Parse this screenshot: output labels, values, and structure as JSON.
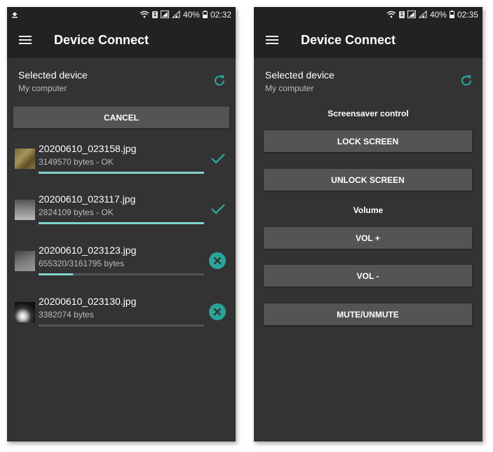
{
  "colors": {
    "accent": "#2aa398",
    "progress": "#7fd4cc",
    "background": "#333333",
    "appbar": "#222222",
    "button": "#545454"
  },
  "left": {
    "status": {
      "left_icon": "upload-icon",
      "battery": "40%",
      "time": "02:32"
    },
    "app_title": "Device Connect",
    "device": {
      "label": "Selected device",
      "name": "My computer"
    },
    "cancel_label": "CANCEL",
    "files": [
      {
        "name": "20200610_023158.jpg",
        "info": "3149570 bytes - OK",
        "progress": 1.0,
        "state": "done",
        "state_icon": "check-icon"
      },
      {
        "name": "20200610_023117.jpg",
        "info": "2824109 bytes - OK",
        "progress": 1.0,
        "state": "done",
        "state_icon": "check-icon"
      },
      {
        "name": "20200610_023123.jpg",
        "info": "655320/3161795 bytes",
        "progress": 0.207,
        "state": "in-progress",
        "state_icon": "cancel-circle-icon"
      },
      {
        "name": "20200610_023130.jpg",
        "info": "3382074 bytes",
        "progress": 0.0,
        "state": "pending",
        "state_icon": "cancel-circle-icon"
      }
    ]
  },
  "right": {
    "status": {
      "battery": "40%",
      "time": "02:35"
    },
    "app_title": "Device Connect",
    "device": {
      "label": "Selected device",
      "name": "My computer"
    },
    "screensaver_label": "Screensaver control",
    "lock_label": "LOCK SCREEN",
    "unlock_label": "UNLOCK SCREEN",
    "volume_label": "Volume",
    "vol_up_label": "VOL +",
    "vol_down_label": "VOL -",
    "mute_label": "MUTE/UNMUTE"
  }
}
